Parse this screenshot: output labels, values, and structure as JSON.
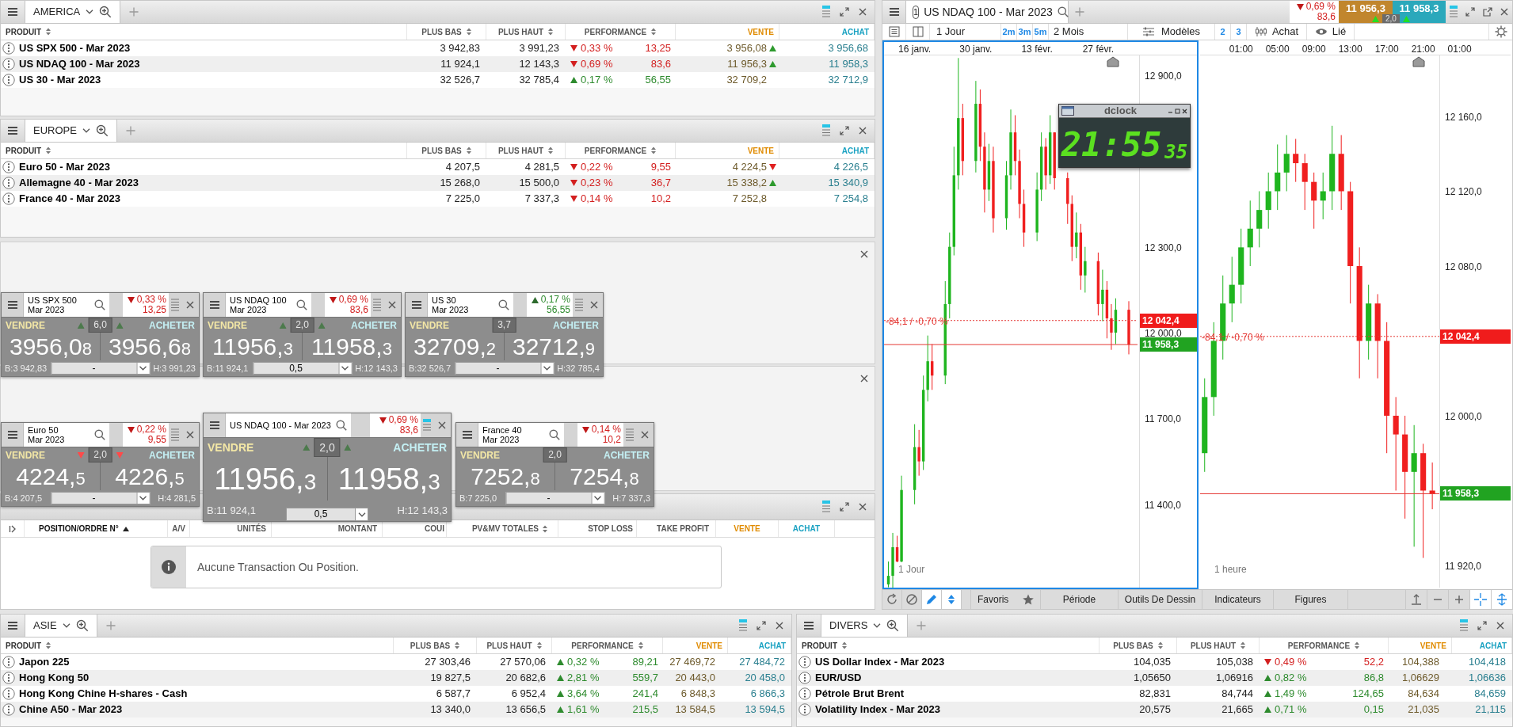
{
  "america": {
    "tab": "AMERICA",
    "columns": [
      {
        "label": "PRODUIT",
        "sortable": true
      },
      {
        "label": "PLUS BAS",
        "sortable": true
      },
      {
        "label": "PLUS HAUT",
        "sortable": true
      },
      {
        "label": "PERFORMANCE",
        "sortable": true
      },
      {
        "label": "VENTE",
        "sortable": false
      },
      {
        "label": "ACHAT",
        "sortable": false
      }
    ],
    "rows": [
      {
        "product": "US SPX 500 - Mar 2023",
        "low": "3 942,83",
        "high": "3 991,23",
        "rising": false,
        "performance": "0,33 %",
        "change": "13,25",
        "sell": "3 956,08",
        "sell_tick_rising": true,
        "buy": "3 956,68"
      },
      {
        "product": "US NDAQ 100 - Mar 2023",
        "low": "11 924,1",
        "high": "12 143,3",
        "rising": false,
        "performance": "0,69 %",
        "change": "83,6",
        "sell": "11 956,3",
        "sell_tick_rising": true,
        "buy": "11 958,3"
      },
      {
        "product": "US 30 - Mar 2023",
        "low": "32 526,7",
        "high": "32 785,4",
        "rising": true,
        "performance": "0,17 %",
        "change": "56,55",
        "sell": "32 709,2",
        "buy": "32 712,9"
      }
    ]
  },
  "europe": {
    "tab": "EUROPE",
    "columns": [
      {
        "label": "PRODUIT",
        "sortable": true
      },
      {
        "label": "PLUS BAS",
        "sortable": true
      },
      {
        "label": "PLUS HAUT",
        "sortable": true
      },
      {
        "label": "PERFORMANCE",
        "sortable": true
      },
      {
        "label": "VENTE",
        "sortable": false
      },
      {
        "label": "ACHAT",
        "sortable": false
      }
    ],
    "rows": [
      {
        "product": "Euro 50 - Mar 2023",
        "low": "4 207,5",
        "high": "4 281,5",
        "rising": false,
        "performance": "0,22 %",
        "change": "9,55",
        "sell": "4 224,5",
        "sell_tick_rising": false,
        "buy": "4 226,5"
      },
      {
        "product": "Allemagne 40 - Mar 2023",
        "low": "15 268,0",
        "high": "15 500,0",
        "rising": false,
        "performance": "0,23 %",
        "change": "36,7",
        "sell": "15 338,2",
        "sell_tick_rising": true,
        "buy": "15 340,9"
      },
      {
        "product": "France 40 - Mar 2023",
        "low": "7 225,0",
        "high": "7 337,3",
        "rising": false,
        "performance": "0,14 %",
        "change": "10,2",
        "sell": "7 252,8",
        "buy": "7 254,8"
      }
    ]
  },
  "ticket_groups": [
    {
      "tickets": [
        {
          "large": false,
          "title_lines": [
            "US SPX 500",
            "Mar 2023"
          ],
          "rising": false,
          "performance": "0,33 %",
          "change": "13,25",
          "sell_label": "VENDRE",
          "buy_label": "ACHETER",
          "spread": "6,0",
          "sell_tick_rising": true,
          "buy_tick_rising": true,
          "sell_price": "3956,08",
          "buy_price": "3956,68",
          "low": "B:3 942,83",
          "high": "H:3 991,23",
          "quantity": "-"
        },
        {
          "large": false,
          "title_lines": [
            "US NDAQ 100",
            "Mar 2023"
          ],
          "rising": false,
          "performance": "0,69 %",
          "change": "83,6",
          "sell_label": "VENDRE",
          "buy_label": "ACHETER",
          "spread": "2,0",
          "sell_tick_rising": true,
          "buy_tick_rising": true,
          "sell_price": "11956,3",
          "buy_price": "11958,3",
          "low": "B:11 924,1",
          "high": "H:12 143,3",
          "quantity": "0,5"
        },
        {
          "large": false,
          "title_lines": [
            "US 30",
            "Mar 2023"
          ],
          "rising": true,
          "performance": "0,17 %",
          "change": "56,55",
          "sell_label": "VENDRE",
          "buy_label": "ACHETER",
          "spread": "3,7",
          "sell_price": "32709,2",
          "buy_price": "32712,9",
          "low": "B:32 526,7",
          "high": "H:32 785,4",
          "quantity": "-"
        }
      ]
    },
    {
      "tickets": [
        {
          "large": false,
          "title_lines": [
            "Euro 50",
            "Mar 2023"
          ],
          "rising": false,
          "performance": "0,22 %",
          "change": "9,55",
          "sell_label": "VENDRE",
          "buy_label": "ACHETER",
          "spread": "2,0",
          "sell_tick_rising": false,
          "buy_tick_rising": false,
          "sell_price": "4224,5",
          "buy_price": "4226,5",
          "low": "B:4 207,5",
          "high": "H:4 281,5",
          "quantity": "-"
        },
        {
          "large": true,
          "title_lines": [
            "US NDAQ 100 - Mar 2023"
          ],
          "rising": false,
          "performance": "0,69 %",
          "change": "83,6",
          "sell_label": "VENDRE",
          "buy_label": "ACHETER",
          "spread": "2,0",
          "sell_tick_rising": true,
          "buy_tick_rising": true,
          "sell_price": "11956,3",
          "buy_price": "11958,3",
          "low": "B:11 924,1",
          "high": "H:12 143,3",
          "quantity": "0,5"
        },
        {
          "large": false,
          "title_lines": [
            "France 40",
            "Mar 2023"
          ],
          "rising": false,
          "performance": "0,14 %",
          "change": "10,2",
          "sell_label": "VENDRE",
          "buy_label": "ACHETER",
          "spread": "2,0",
          "sell_price": "7252,8",
          "buy_price": "7254,8",
          "low": "B:7 225,0",
          "high": "H:7 337,3",
          "quantity": "-"
        }
      ]
    }
  ],
  "positions": {
    "columns": [
      {
        "label": "POSITION/ORDRE N°",
        "sortable": true,
        "sorted": true
      },
      {
        "label": "A/V",
        "sortable": false,
        "sorted": false
      },
      {
        "label": "UNITÉS",
        "sortable": false,
        "sorted": false
      },
      {
        "label": "MONTANT",
        "sortable": false,
        "sorted": false
      },
      {
        "label": "COUI",
        "sortable": false,
        "sorted": false
      },
      {
        "label": "PV&MV TOTALES",
        "sortable": true,
        "sorted": false
      },
      {
        "label": "STOP LOSS",
        "sortable": false,
        "sorted": false
      },
      {
        "label": "TAKE PROFIT",
        "sortable": false,
        "sorted": false
      },
      {
        "label": "VENTE",
        "sortable": false,
        "sorted": false
      },
      {
        "label": "ACHAT",
        "sortable": false,
        "sorted": false
      }
    ],
    "message": "Aucune Transaction Ou Position."
  },
  "chart": {
    "tab": {
      "number": "1",
      "title": "US NDAQ 100 - Mar 2023"
    },
    "quote": {
      "rising": false,
      "performance": "0,69 %",
      "change": "83,6",
      "sell": "11 956,3",
      "buy": "11 958,3",
      "spread": "2,0",
      "sell_tick_rising": true,
      "buy_tick_rising": true
    },
    "toolbar": {
      "period": "1 Jour",
      "quick_periods": [
        "2m",
        "3m",
        "5m"
      ],
      "range": "2 Mois",
      "templates": "Modèles",
      "layouts": [
        "2",
        "3"
      ],
      "chart_type": "Achat",
      "link": "Lié"
    },
    "panes": [
      {
        "selected": true,
        "label": "1 Jour",
        "change_label": "-84,1 / -0,70 %",
        "markers": [
          {
            "label": "12 042,4",
            "color": "#f01c1c"
          },
          {
            "label": "11 958,3",
            "color": "#21a321"
          }
        ],
        "chart_data": {
          "type": "candlestick",
          "x": [
            "2023-01-10",
            "2023-01-11",
            "2023-01-12",
            "2023-01-13",
            "2023-01-16",
            "2023-01-17",
            "2023-01-18",
            "2023-01-19",
            "2023-01-20",
            "2023-01-23",
            "2023-01-24",
            "2023-01-25",
            "2023-01-26",
            "2023-01-27",
            "2023-01-30",
            "2023-01-31",
            "2023-02-01",
            "2023-02-02",
            "2023-02-03",
            "2023-02-06",
            "2023-02-07",
            "2023-02-08",
            "2023-02-09",
            "2023-02-10",
            "2023-02-13",
            "2023-02-14",
            "2023-02-15",
            "2023-02-16",
            "2023-02-17",
            "2023-02-20",
            "2023-02-21",
            "2023-02-22",
            "2023-02-23",
            "2023-02-24",
            "2023-02-27",
            "2023-02-28",
            "2023-03-01",
            "2023-03-02",
            "2023-03-03",
            "2023-03-06"
          ],
          "ohlc": [
            [
              11120,
              11200,
              11110,
              11150
            ],
            [
              11150,
              11300,
              11100,
              11250
            ],
            [
              11250,
              11290,
              11195,
              11200
            ],
            [
              11200,
              11500,
              11195,
              11450
            ],
            [
              11450,
              11680,
              11400,
              11600
            ],
            [
              11600,
              11660,
              11500,
              11550
            ],
            [
              11550,
              11850,
              11520,
              11800
            ],
            [
              11800,
              11990,
              11760,
              11900
            ],
            [
              11900,
              11960,
              11800,
              11850
            ],
            [
              11850,
              12180,
              11820,
              12100
            ],
            [
              12100,
              12350,
              12050,
              12300
            ],
            [
              12300,
              12650,
              12270,
              12550
            ],
            [
              12550,
              12960,
              12500,
              12750
            ],
            [
              12750,
              12800,
              12550,
              12600
            ],
            [
              12600,
              12880,
              12560,
              12800
            ],
            [
              12800,
              12850,
              12600,
              12650
            ],
            [
              12650,
              12700,
              12420,
              12500
            ],
            [
              12500,
              12660,
              12460,
              12600
            ],
            [
              12600,
              12650,
              12350,
              12400
            ],
            [
              12400,
              12600,
              12360,
              12550
            ],
            [
              12550,
              12780,
              12500,
              12700
            ],
            [
              12700,
              12760,
              12550,
              12600
            ],
            [
              12600,
              12640,
              12400,
              12450
            ],
            [
              12450,
              12500,
              12300,
              12350
            ],
            [
              12350,
              12560,
              12320,
              12500
            ],
            [
              12500,
              12700,
              12460,
              12650
            ],
            [
              12650,
              12680,
              12500,
              12550
            ],
            [
              12550,
              12760,
              12520,
              12700
            ],
            [
              12700,
              12700,
              12500,
              12540
            ],
            [
              12540,
              12560,
              12380,
              12450
            ],
            [
              12450,
              12480,
              12250,
              12300
            ],
            [
              12300,
              12420,
              12260,
              12350
            ],
            [
              12350,
              12380,
              12150,
              12200
            ],
            [
              12200,
              12300,
              12140,
              12250
            ],
            [
              12250,
              12280,
              12060,
              12100
            ],
            [
              12100,
              12220,
              12040,
              12150
            ],
            [
              12150,
              12180,
              11980,
              12050
            ],
            [
              12050,
              12100,
              11940,
              12000
            ],
            [
              12000,
              12120,
              11960,
              12080
            ],
            [
              12080,
              12110,
              11924.1,
              11958.3
            ]
          ],
          "ylim": [
            11106,
            12969
          ],
          "xlim": [
            "2023-01-09",
            "2023-03-21T14:00"
          ],
          "ref_lines": [
            {
              "axis": "y",
              "value": 12042.4
            },
            {
              "axis": "y",
              "value": 11958.3
            }
          ],
          "xticks": [
            {
              "value": "2023-01-16",
              "label": "16 janv."
            },
            {
              "value": "2023-01-30",
              "label": "30 janv."
            },
            {
              "value": "2023-02-13",
              "label": "13 févr."
            },
            {
              "value": "2023-02-27",
              "label": "27 févr."
            }
          ],
          "yticks": [
            {
              "value": 12900,
              "label": "12 900,0"
            },
            {
              "value": 12300,
              "label": "12 300,0"
            },
            {
              "value": 12000,
              "label": "12 000,0"
            },
            {
              "value": 11700,
              "label": "11 700,0"
            },
            {
              "value": 11400,
              "label": "11 400,0"
            }
          ]
        }
      },
      {
        "selected": false,
        "label": "1 heure",
        "change_label": "-84,1 / -0,70 %",
        "markers": [
          {
            "label": "12 042,4",
            "color": "#f01c1c"
          },
          {
            "label": "11 958,3",
            "color": "#21a321"
          }
        ],
        "chart_data": {
          "type": "candlestick",
          "x": [
            "2023-03-05T21:00",
            "2023-03-05T22:00",
            "2023-03-05T23:00",
            "2023-03-06T00:00",
            "2023-03-06T01:00",
            "2023-03-06T02:00",
            "2023-03-06T03:00",
            "2023-03-06T04:00",
            "2023-03-06T05:00",
            "2023-03-06T06:00",
            "2023-03-06T07:00",
            "2023-03-06T08:00",
            "2023-03-06T09:00",
            "2023-03-06T10:00",
            "2023-03-06T11:00",
            "2023-03-06T12:00",
            "2023-03-06T13:00",
            "2023-03-06T14:00",
            "2023-03-06T15:00",
            "2023-03-06T16:00",
            "2023-03-06T17:00",
            "2023-03-06T18:00",
            "2023-03-06T19:00",
            "2023-03-06T20:00",
            "2023-03-06T21:00",
            "2023-03-06T22:00"
          ],
          "ohlc": [
            [
              11980,
              12020,
              11970,
              12010
            ],
            [
              12010,
              12050,
              12000,
              12040
            ],
            [
              12040,
              12075,
              12030,
              12060
            ],
            [
              12060,
              12085,
              12050,
              12070
            ],
            [
              12070,
              12100,
              12060,
              12090
            ],
            [
              12090,
              12115,
              12080,
              12100
            ],
            [
              12100,
              12120,
              12090,
              12110
            ],
            [
              12110,
              12130,
              12100,
              12120
            ],
            [
              12120,
              12145,
              12110,
              12130
            ],
            [
              12130,
              12150,
              12120,
              12140
            ],
            [
              12140,
              12148,
              12125,
              12135
            ],
            [
              12135,
              12140,
              12110,
              12125
            ],
            [
              12125,
              12130,
              12100,
              12115
            ],
            [
              12115,
              12130,
              12105,
              12120
            ],
            [
              12120,
              12155,
              12110,
              12140
            ],
            [
              12140,
              12150,
              12110,
              12120
            ],
            [
              12120,
              12125,
              12060,
              12080
            ],
            [
              12080,
              12090,
              12020,
              12040
            ],
            [
              12040,
              12070,
              12030,
              12060
            ],
            [
              12060,
              12065,
              12020,
              12040
            ],
            [
              12040,
              12050,
              11980,
              12000
            ],
            [
              12000,
              12010,
              11960,
              11990
            ],
            [
              11990,
              12000,
              11945,
              11970
            ],
            [
              11970,
              11995,
              11930,
              11980
            ],
            [
              11980,
              11985,
              11924,
              11960
            ],
            [
              11960,
              11975,
              11950,
              11958.3
            ]
          ],
          "ylim": [
            11907.7,
            12192.6
          ],
          "xlim": [
            "2023-03-05T20:30",
            "2023-03-07T06:36"
          ],
          "ref_lines": [
            {
              "axis": "y",
              "value": 12042.4
            },
            {
              "axis": "y",
              "value": 11958.3
            }
          ],
          "xticks": [
            {
              "value": "2023-03-06T01:00",
              "label": "01:00"
            },
            {
              "value": "2023-03-06T05:00",
              "label": "05:00"
            },
            {
              "value": "2023-03-06T09:00",
              "label": "09:00"
            },
            {
              "value": "2023-03-06T13:00",
              "label": "13:00"
            },
            {
              "value": "2023-03-06T17:00",
              "label": "17:00"
            },
            {
              "value": "2023-03-06T21:00",
              "label": "21:00"
            },
            {
              "value": "2023-03-07T01:00",
              "label": "01:00"
            }
          ],
          "yticks": [
            {
              "value": 12160,
              "label": "12 160,0"
            },
            {
              "value": 12120,
              "label": "12 120,0"
            },
            {
              "value": 12080,
              "label": "12 080,0"
            },
            {
              "value": 12000,
              "label": "12 000,0"
            },
            {
              "value": 11920,
              "label": "11 920,0"
            }
          ]
        }
      }
    ],
    "bottom_toolbar": {
      "favorites": "Favoris",
      "sections": [
        "Période",
        "Outils De Dessin",
        "Indicateurs",
        "Figures"
      ]
    },
    "dclock": {
      "title": "dclock",
      "time": "21:55",
      "seconds": "35"
    }
  },
  "asie": {
    "tab": "ASIE",
    "columns": [
      {
        "label": "PRODUIT",
        "sortable": true
      },
      {
        "label": "PLUS BAS",
        "sortable": true
      },
      {
        "label": "PLUS HAUT",
        "sortable": true
      },
      {
        "label": "PERFORMANCE",
        "sortable": true
      },
      {
        "label": "VENTE",
        "sortable": false
      },
      {
        "label": "ACHAT",
        "sortable": false
      }
    ],
    "rows": [
      {
        "product": "Japon 225",
        "low": "27 303,46",
        "high": "27 570,06",
        "rising": true,
        "performance": "0,32 %",
        "change": "89,21",
        "sell": "27 469,72",
        "buy": "27 484,72"
      },
      {
        "product": "Hong Kong 50",
        "low": "19 827,5",
        "high": "20 682,6",
        "rising": true,
        "performance": "2,81 %",
        "change": "559,7",
        "sell": "20 443,0",
        "buy": "20 458,0"
      },
      {
        "product": "Hong Kong Chine H-shares - Cash",
        "low": "6 587,7",
        "high": "6 952,4",
        "rising": true,
        "performance": "3,64 %",
        "change": "241,4",
        "sell": "6 848,3",
        "buy": "6 866,3"
      },
      {
        "product": "Chine A50 - Mar 2023",
        "low": "13 340,0",
        "high": "13 656,5",
        "rising": true,
        "performance": "1,61 %",
        "change": "215,5",
        "sell": "13 584,5",
        "buy": "13 594,5"
      }
    ]
  },
  "divers": {
    "tab": "DIVERS",
    "columns": [
      {
        "label": "PRODUIT",
        "sortable": true
      },
      {
        "label": "PLUS BAS",
        "sortable": true
      },
      {
        "label": "PLUS HAUT",
        "sortable": true
      },
      {
        "label": "PERFORMANCE",
        "sortable": true
      },
      {
        "label": "VENTE",
        "sortable": false
      },
      {
        "label": "ACHAT",
        "sortable": false
      }
    ],
    "rows": [
      {
        "product": "US Dollar Index - Mar 2023",
        "low": "104,035",
        "high": "105,038",
        "rising": false,
        "performance": "0,49 %",
        "change": "52,2",
        "sell": "104,388",
        "buy": "104,418"
      },
      {
        "product": "EUR/USD",
        "low": "1,05650",
        "high": "1,06916",
        "rising": true,
        "performance": "0,82 %",
        "change": "86,8",
        "sell": "1,06629",
        "buy": "1,06636"
      },
      {
        "product": "Pétrole Brut Brent",
        "low": "82,831",
        "high": "84,744",
        "rising": true,
        "performance": "1,49 %",
        "change": "124,65",
        "sell": "84,634",
        "buy": "84,659"
      },
      {
        "product": "Volatility Index - Mar 2023",
        "low": "20,575",
        "high": "21,665",
        "rising": true,
        "performance": "0,71 %",
        "change": "0,15",
        "sell": "21,035",
        "buy": "21,115"
      }
    ]
  }
}
